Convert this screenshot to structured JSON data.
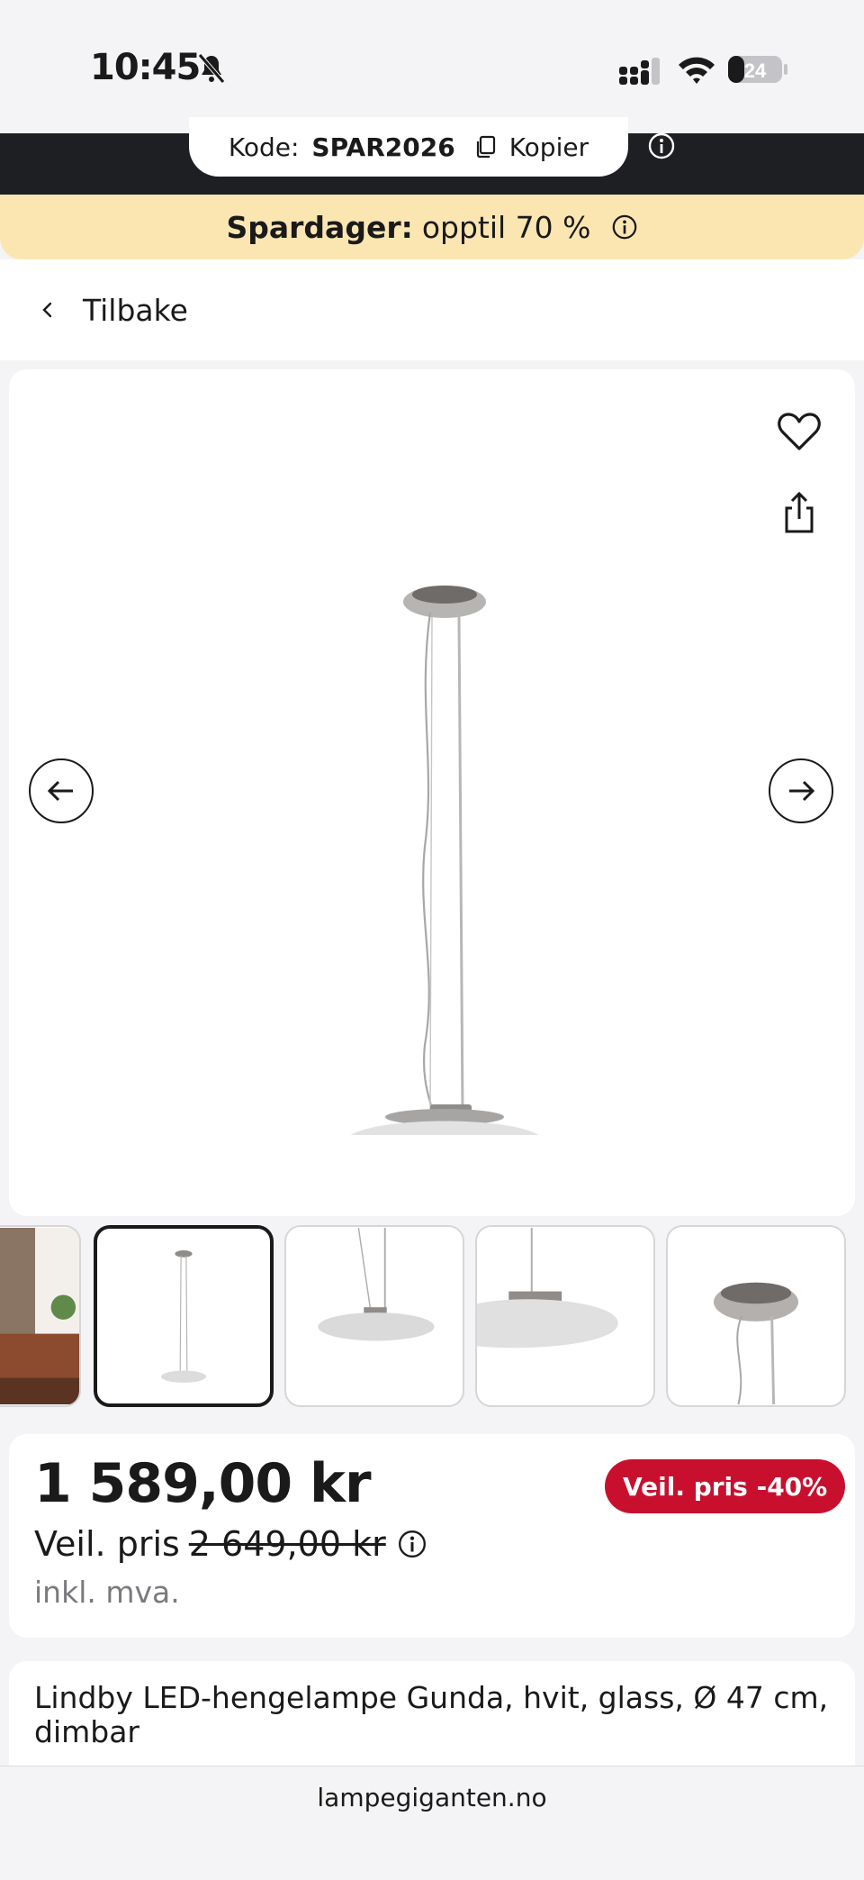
{
  "status_bar": {
    "time": "10:45",
    "battery": "24",
    "icons": [
      "bell-slash-icon",
      "cellular-signal-icon",
      "wifi-icon",
      "battery-icon"
    ]
  },
  "promo": {
    "code_label": "Kode:",
    "code_value": "SPAR2026",
    "copy_label": "Kopier"
  },
  "sale_banner": {
    "bold": "Spardager:",
    "text": "opptil 70 %"
  },
  "nav": {
    "back_label": "Tilbake"
  },
  "gallery": {
    "thumbnail_count": 5,
    "active_index": 1
  },
  "price": {
    "current": "1 589,00 kr",
    "rrp_label": "Veil. pris",
    "rrp_value": "2 649,00 kr",
    "vat_note": "inkl. mva.",
    "discount_badge": "Veil. pris -40%"
  },
  "product": {
    "title": "Lindby LED-hengelampe Gunda, hvit, glass, Ø 47 cm, dimbar"
  },
  "browser": {
    "url": "lampegiganten.no"
  },
  "colors": {
    "promo_dark": "#1e1f22",
    "banner_yellow": "#fbe6b2",
    "discount_red": "#c8102e"
  }
}
